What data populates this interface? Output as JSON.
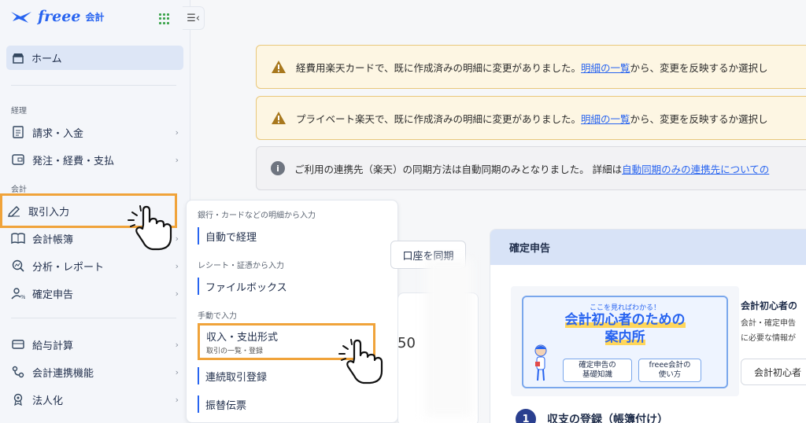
{
  "sidebar": {
    "logo": {
      "brand": "freee",
      "product": "会計"
    },
    "collapse_glyph": "☰‹",
    "home": "ホーム",
    "sections": {
      "keiri": "経理",
      "kaikei": "会計"
    },
    "items": {
      "seikyu": "請求・入金",
      "hatchu": "発注・経費・支払",
      "torihiki": "取引入力",
      "choubo": "会計帳簿",
      "bunseki": "分析・レポート",
      "kakutei": "確定申告",
      "kyuyo": "給与計算",
      "renkei": "会計連携機能",
      "hojin": "法人化"
    }
  },
  "submenu": {
    "label_bank": "銀行・カードなどの明細から入力",
    "auto": "自動で経理",
    "label_receipt": "レシート・証憑から入力",
    "filebox": "ファイルボックス",
    "label_manual": "手動で入力",
    "income": "収入・支出形式",
    "income_sub": "取引の一覧・登録",
    "renzoku": "連続取引登録",
    "furikae": "振替伝票"
  },
  "alerts": [
    {
      "pre": "経費用楽天カードで、既に作成済みの明細に変更がありました。",
      "link": "明細の一覧",
      "post": "から、変更を反映するか選択し"
    },
    {
      "pre": "プライベート楽天で、既に作成済みの明細に変更がありました。",
      "link": "明細の一覧",
      "post": "から、変更を反映するか選択し"
    },
    {
      "pre": "ご利用の連携先（楽天）の同期方法は自動同期のみとなりました。 詳細は",
      "link": "自動同期のみの連携先についての",
      "post": ""
    }
  ],
  "main": {
    "sync_button": "口座を同期",
    "partial_number": "50",
    "kakutei": {
      "header": "確定申告",
      "banner_kicker": "ここを見ればわかる！",
      "banner_title_1": "会計初心者のための",
      "banner_title_2": "案内所",
      "banner_btn_1": "確定申告の\n基礎知識",
      "banner_btn_2": "freee会計の\n使い方",
      "side_title": "会計初心者の",
      "side_text_1": "会計・確定申告",
      "side_text_2": "に必要な情報が",
      "side_button": "会計初心者",
      "step_num": "1",
      "step_label": "収支の登録（帳簿付け）"
    }
  },
  "colors": {
    "accent": "#2864f0",
    "highlight": "#f0a33a",
    "warn_bg": "#fdf6e3"
  }
}
